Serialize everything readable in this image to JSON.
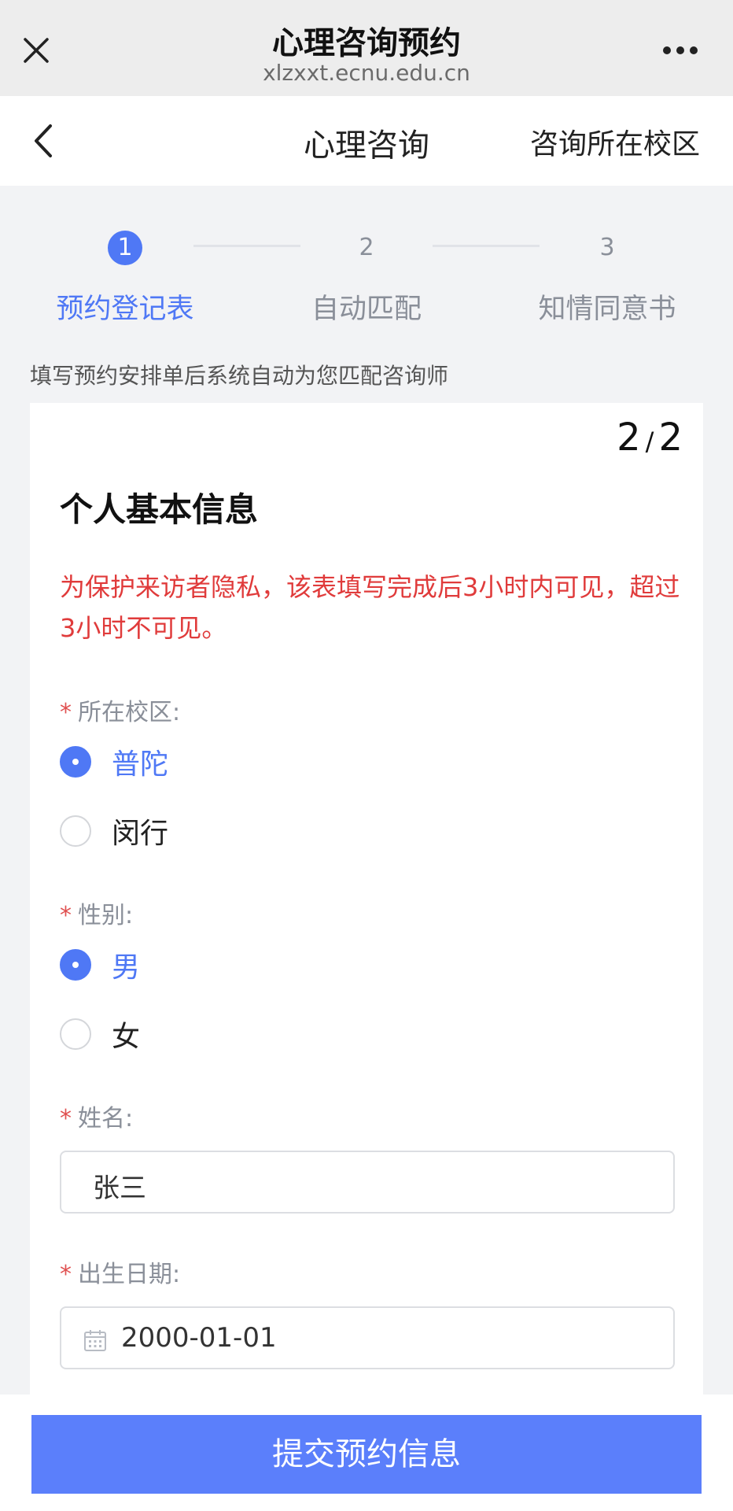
{
  "topbar": {
    "title": "心理咨询预约",
    "domain": "xlzxxt.ecnu.edu.cn",
    "close_icon": "close-icon",
    "more_icon": "more-dots-icon"
  },
  "navbar": {
    "title": "心理咨询",
    "right_link": "咨询所在校区",
    "back_icon": "chevron-left-icon"
  },
  "steps": [
    {
      "num": "1",
      "label": "预约登记表",
      "active": true
    },
    {
      "num": "2",
      "label": "自动匹配",
      "active": false
    },
    {
      "num": "3",
      "label": "知情同意书",
      "active": false
    }
  ],
  "hint": "填写预约安排单后系统自动为您匹配咨询师",
  "card": {
    "pager_current": "2",
    "pager_separator": "/",
    "pager_total": "2",
    "section_title": "个人基本信息",
    "privacy_notice": "为保护来访者隐私，该表填写完成后3小时内可见，超过3小时不可见。",
    "required_mark": "*",
    "campus": {
      "label": "所在校区:",
      "options": [
        {
          "text": "普陀",
          "checked": true
        },
        {
          "text": "闵行",
          "checked": false
        }
      ]
    },
    "gender": {
      "label": "性别:",
      "options": [
        {
          "text": "男",
          "checked": true
        },
        {
          "text": "女",
          "checked": false
        }
      ]
    },
    "name": {
      "label": "姓名:",
      "value": "张三"
    },
    "birthdate": {
      "label": "出生日期:",
      "value": "2000-01-01",
      "icon": "calendar-icon"
    }
  },
  "submit_label": "提交预约信息",
  "colors": {
    "accent": "#4f78f5",
    "submit": "#5b7ffb",
    "warning": "#e03b3b",
    "required": "#e05050"
  }
}
